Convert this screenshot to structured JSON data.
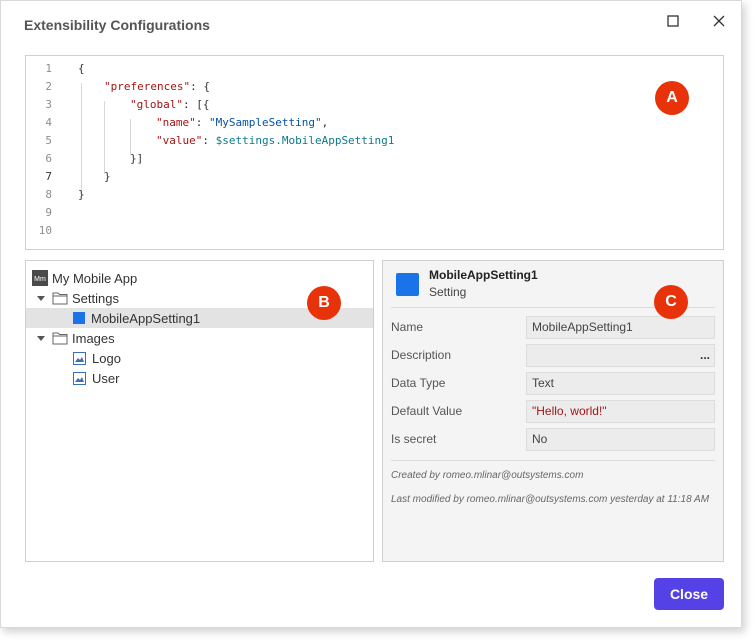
{
  "window": {
    "title": "Extensibility Configurations"
  },
  "editor": {
    "line_numbers": [
      "1",
      "2",
      "3",
      "4",
      "5",
      "6",
      "7",
      "8",
      "9",
      "10"
    ],
    "lines": [
      [
        {
          "t": "p",
          "v": "{"
        }
      ],
      [
        {
          "t": "k",
          "v": "\"preferences\""
        },
        {
          "t": "p",
          "v": ": {"
        }
      ],
      [
        {
          "t": "k",
          "v": "\"global\""
        },
        {
          "t": "p",
          "v": ": [{"
        }
      ],
      [
        {
          "t": "k",
          "v": "\"name\""
        },
        {
          "t": "p",
          "v": ": "
        },
        {
          "t": "s",
          "v": "\"MySampleSetting\""
        },
        {
          "t": "p",
          "v": ","
        }
      ],
      [
        {
          "t": "k",
          "v": "\"value\""
        },
        {
          "t": "p",
          "v": ": "
        },
        {
          "t": "v",
          "v": "$settings.MobileAppSetting1"
        }
      ],
      [
        {
          "t": "p",
          "v": "}]"
        }
      ],
      [
        {
          "t": "p",
          "v": "}"
        }
      ],
      [
        {
          "t": "p",
          "v": "}"
        }
      ],
      [],
      []
    ]
  },
  "badges": {
    "a": "A",
    "b": "B",
    "c": "C"
  },
  "tree": {
    "root": {
      "icon_text": "Mm",
      "label": "My Mobile App"
    },
    "settings_folder": "Settings",
    "setting_item": "MobileAppSetting1",
    "images_folder": "Images",
    "image_items": [
      "Logo",
      "User"
    ]
  },
  "details": {
    "name": "MobileAppSetting1",
    "type": "Setting",
    "properties": [
      {
        "label": "Name",
        "value": "MobileAppSetting1"
      },
      {
        "label": "Description",
        "value": ""
      },
      {
        "label": "Data Type",
        "value": "Text"
      },
      {
        "label": "Default Value",
        "value": "\"Hello, world!\""
      },
      {
        "label": "Is secret",
        "value": "No"
      }
    ],
    "description_more": "...",
    "created_by": "Created by romeo.mlinar@outsystems.com",
    "modified_by": "Last modified by romeo.mlinar@outsystems.com yesterday at 11:18 AM"
  },
  "footer": {
    "close_label": "Close"
  },
  "colors": {
    "accent": "#5442e6",
    "badge": "#e8330a",
    "setting_icon": "#1a73e8"
  }
}
